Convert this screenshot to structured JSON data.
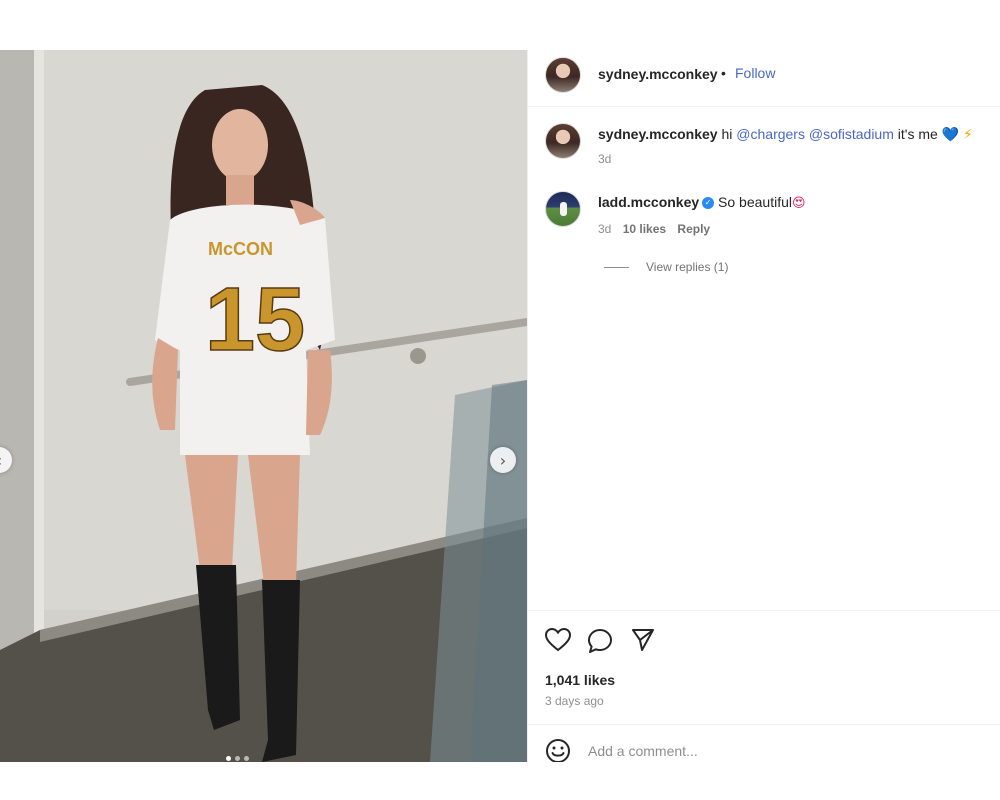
{
  "post": {
    "author": "sydney.mcconkey",
    "follow_label": "Follow",
    "separator": "•",
    "caption": {
      "username": "sydney.mcconkey",
      "text_prefix": "hi",
      "mention_1": "@chargers",
      "mention_2": "@sofistadium",
      "text_suffix": "it's me",
      "emoji_heart": "💙",
      "emoji_bolt": "⚡",
      "time": "3d"
    },
    "comments": [
      {
        "username": "ladd.mcconkey",
        "verified": true,
        "text": "So beautiful",
        "emoji": "😍",
        "time": "3d",
        "likes": "10 likes",
        "reply_label": "Reply",
        "view_replies": "View replies (1)"
      }
    ],
    "likes": "1,041 likes",
    "posted": "3 days ago",
    "comment_placeholder": "Add a comment..."
  },
  "photo": {
    "jersey_name": "McCON",
    "jersey_number": "15",
    "carousel_dots": 3,
    "active_dot": 0
  },
  "icons": {
    "like": "heart-outline-icon",
    "comment": "speech-bubble-icon",
    "share": "paper-plane-icon",
    "emoji": "smiley-icon",
    "next": "chevron-right-icon",
    "prev": "chevron-left-icon"
  },
  "colors": {
    "link_blue": "#4a67c9",
    "muted": "#8e8e8e",
    "text": "#262626",
    "verified": "#2a8af6",
    "jersey_gold": "#c8962c"
  }
}
